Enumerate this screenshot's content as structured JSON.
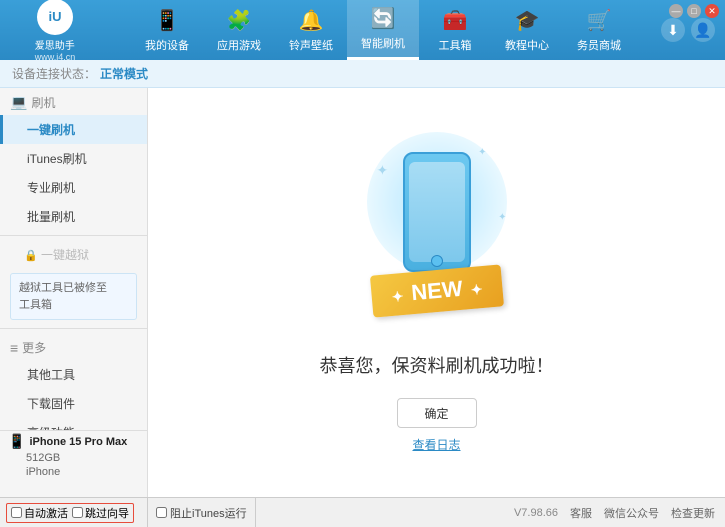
{
  "app": {
    "logo_text": "爱思助手",
    "logo_sub": "www.i4.cn",
    "logo_icon": "iU"
  },
  "nav": {
    "items": [
      {
        "label": "我的设备",
        "icon": "📱"
      },
      {
        "label": "应用游戏",
        "icon": "🧩"
      },
      {
        "label": "铃声壁纸",
        "icon": "🔔"
      },
      {
        "label": "智能刷机",
        "icon": "🔄"
      },
      {
        "label": "工具箱",
        "icon": "🧰"
      },
      {
        "label": "教程中心",
        "icon": "🎓"
      },
      {
        "label": "务员商城",
        "icon": "🛒"
      }
    ],
    "active_index": 3
  },
  "status": {
    "label": "设备连接状态：",
    "mode_prefix": "正常模式"
  },
  "sidebar": {
    "section1_label": "刷机",
    "items": [
      {
        "label": "一键刷机",
        "active": true
      },
      {
        "label": "iTunes刷机",
        "active": false
      },
      {
        "label": "专业刷机",
        "active": false
      },
      {
        "label": "批量刷机",
        "active": false
      }
    ],
    "disabled_label": "一键越狱",
    "note_text": "越狱工具已被修至\n工具箱",
    "section2_label": "更多",
    "more_items": [
      {
        "label": "其他工具"
      },
      {
        "label": "下载固件"
      },
      {
        "label": "高级功能"
      }
    ]
  },
  "content": {
    "success_text": "恭喜您，保资料刷机成功啦！",
    "confirm_btn": "确定",
    "log_link": "查看日志",
    "new_badge": "NEW"
  },
  "device": {
    "name": "iPhone 15 Pro Max",
    "capacity": "512GB",
    "type": "iPhone",
    "icon": "📱"
  },
  "bottom": {
    "checkboxes": [
      {
        "label": "自动激活"
      },
      {
        "label": "跳过向导"
      }
    ],
    "itunes_label": "阻止iTunes运行",
    "version": "V7.98.66",
    "links": [
      "客服",
      "微信公众号",
      "检查更新"
    ]
  },
  "window": {
    "controls": [
      "—",
      "□",
      "✕"
    ]
  }
}
